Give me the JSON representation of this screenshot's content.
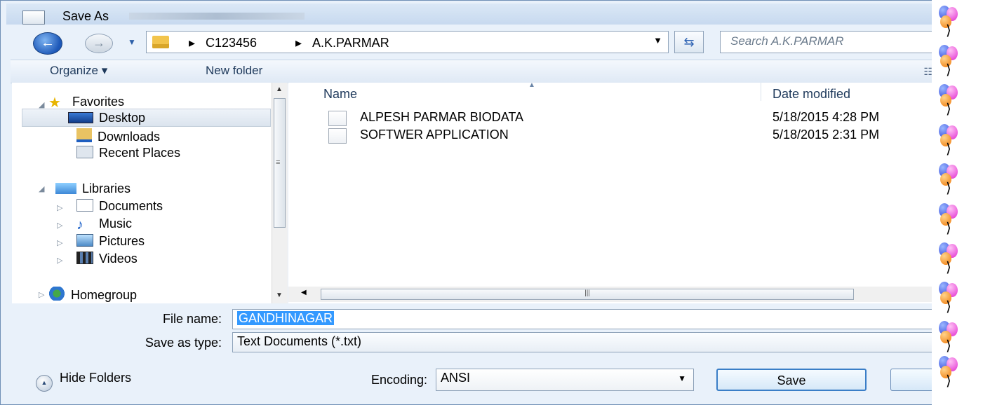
{
  "window": {
    "title": "Save As"
  },
  "nav": {
    "back_icon": "arrow-left-icon",
    "forward_icon": "arrow-right-icon",
    "breadcrumb": [
      "C123456",
      "A.K.PARMAR"
    ],
    "search_placeholder": "Search A.K.PARMAR"
  },
  "toolbar": {
    "organize_label": "Organize ▾",
    "new_folder_label": "New folder"
  },
  "sidebar": {
    "favorites": "Favorites",
    "desktop": "Desktop",
    "downloads": "Downloads",
    "recent_places": "Recent Places",
    "libraries": "Libraries",
    "documents": "Documents",
    "music": "Music",
    "pictures": "Pictures",
    "videos": "Videos",
    "homegroup": "Homegroup"
  },
  "files": {
    "columns": [
      "Name",
      "Date modified"
    ],
    "rows": [
      {
        "name": "ALPESH PARMAR BIODATA",
        "date": "5/18/2015 4:28 PM"
      },
      {
        "name": "SOFTWER APPLICATION",
        "date": "5/18/2015 2:31 PM"
      }
    ]
  },
  "form": {
    "file_name_label": "File name:",
    "file_name_value": "GANDHINAGAR",
    "save_as_type_label": "Save as type:",
    "save_as_type_value": "Text Documents (*.txt)",
    "encoding_label": "Encoding:",
    "encoding_value": "ANSI"
  },
  "buttons": {
    "hide_folders": "Hide Folders",
    "save": "Save"
  },
  "colors": {
    "selection": "#3399ff",
    "window_bg": "#e9f1fa",
    "border": "#8ea2b9"
  }
}
